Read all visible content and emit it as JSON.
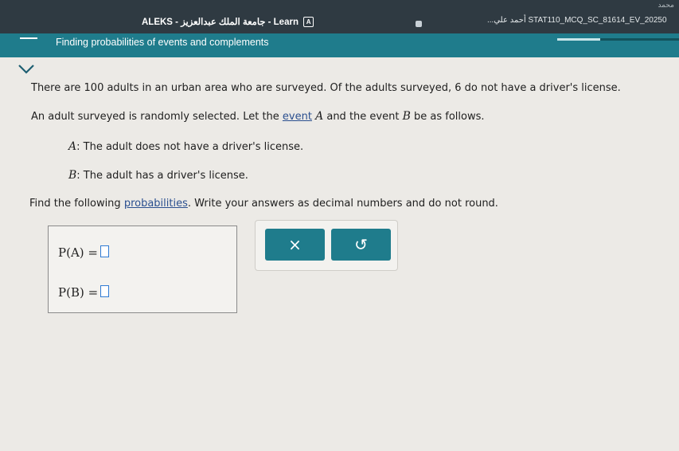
{
  "window": {
    "title": "ALEKS - جامعة الملك عبدالعزيز - Learn",
    "badge": "A",
    "second_tab": "...أحمد علي STAT110_MCQ_SC_81614_EV_20250",
    "corner": "محمد"
  },
  "topic": {
    "title": "Finding probabilities of events and complements",
    "progress_fraction": 0.35
  },
  "problem": {
    "line1": "There are 100 adults in an urban area who are surveyed. Of the adults surveyed, 6 do not have a driver's license.",
    "line2_a": "An adult surveyed is randomly selected. Let the ",
    "line2_link": "event",
    "line2_var": "A",
    "line2_b": " and the event ",
    "line2_var2": "B",
    "line2_c": " be as follows.",
    "eventA_var": "A",
    "eventA_text": ": The adult does not have a driver's license.",
    "eventB_var": "B",
    "eventB_text": ": The adult has a driver's license.",
    "instr_a": "Find the following ",
    "instr_link": "probabilities",
    "instr_b": ". Write your answers as decimal numbers and do not round."
  },
  "answers": {
    "pa_label": "P(A) =",
    "pb_label": "P(B) =",
    "pa_value": "",
    "pb_value": ""
  },
  "buttons": {
    "clear_label": "×",
    "undo_label": "↺"
  },
  "colors": {
    "teal": "#1f7c8c",
    "header": "#2f3a42",
    "input_border": "#2f7bd4"
  }
}
